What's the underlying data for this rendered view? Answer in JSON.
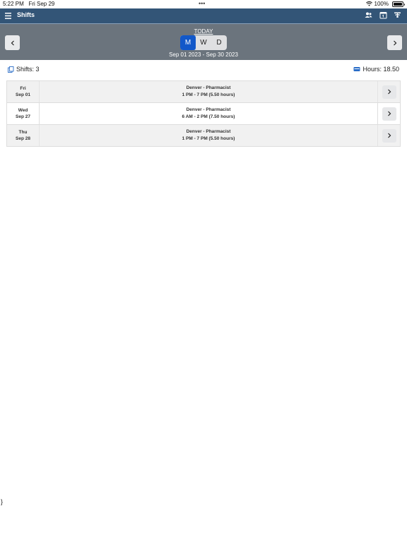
{
  "status_bar": {
    "time": "5:22 PM",
    "date": "Fri Sep 29",
    "dots": "•••",
    "battery": "100%"
  },
  "navbar": {
    "title": "Shifts",
    "icons": [
      "menu-icon",
      "people-icon",
      "calendar-icon",
      "filter-icon"
    ]
  },
  "date_header": {
    "today_label": "TODAY",
    "segments": [
      "M",
      "W",
      "D"
    ],
    "selected_segment": "M",
    "range": "Sep 01 2023 - Sep 30 2023"
  },
  "summary": {
    "shifts_label": "Shifts: 3",
    "hours_label": "Hours: 18.50"
  },
  "shifts": [
    {
      "day": "Fri",
      "date": "Sep 01",
      "location": "Denver - Pharmacist",
      "time": "1 PM - 7 PM (5.50 hours)"
    },
    {
      "day": "Wed",
      "date": "Sep 27",
      "location": "Denver - Pharmacist",
      "time": "6 AM - 2 PM (7.50 hours)"
    },
    {
      "day": "Thu",
      "date": "Sep 28",
      "location": "Denver - Pharmacist",
      "time": "1 PM - 7 PM (5.50 hours)"
    }
  ],
  "stray_text": "}",
  "colors": {
    "navbar": "#335577",
    "datebar": "#6b747d",
    "segment_active": "#1258c9",
    "row_alt": "#f1f1f1"
  }
}
